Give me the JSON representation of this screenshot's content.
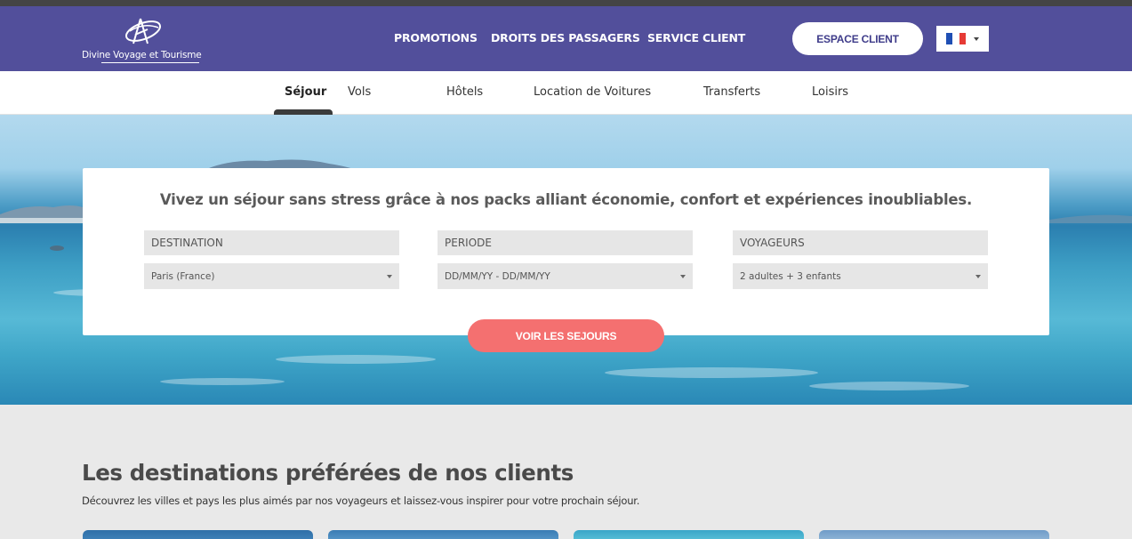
{
  "brand": {
    "name": "Divine Voyage et Tourisme",
    "color": "#524f9b"
  },
  "nav": {
    "items": [
      "PROMOTIONS",
      "DROITS DES PASSAGERS",
      "SERVICE CLIENT"
    ]
  },
  "header": {
    "client_button": "ESPACE CLIENT",
    "language": "fr-flag-icon"
  },
  "tabs": [
    "Séjour",
    "Vols",
    "Hôtels",
    "Location de Voitures",
    "Transferts",
    "Loisirs"
  ],
  "search": {
    "title": "Vivez un séjour sans stress grâce à nos packs alliant économie, confort et expériences inoubliables.",
    "destination": {
      "label": "DESTINATION",
      "value": "Paris (France)"
    },
    "period": {
      "label": "PERIODE",
      "value": "DD/MM/YY - DD/MM/YY"
    },
    "travelers": {
      "label": "VOYAGEURS",
      "value": "2 adultes + 3 enfants"
    },
    "button": "VOIR LES SEJOURS",
    "button_color": "#f47070"
  },
  "destinations": {
    "title": "Les destinations préférées de nos clients",
    "subtitle": "Découvrez les villes et pays les plus aimés par nos voyageurs et laissez-vous inspirer pour votre prochain séjour."
  }
}
